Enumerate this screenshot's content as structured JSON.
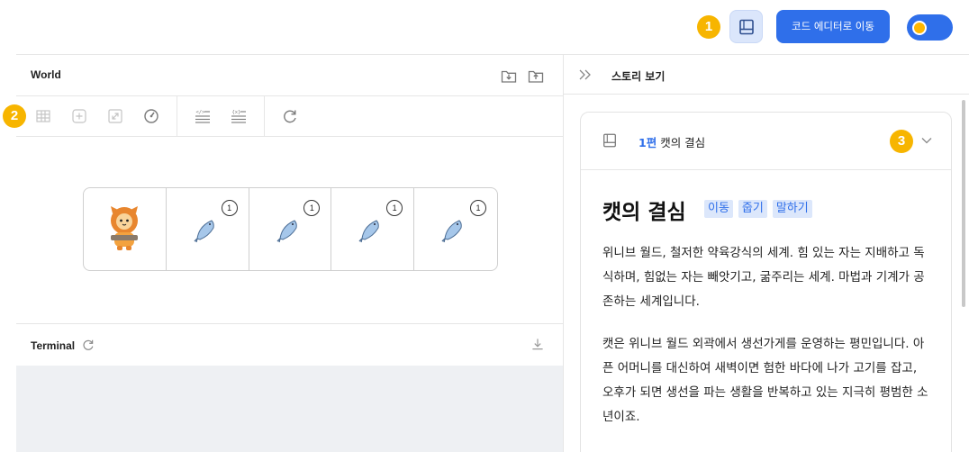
{
  "topbar": {
    "badge_1": "1",
    "code_editor_label": "코드 에디터로 이동",
    "story_icon": "book-icon",
    "theme_toggle": "theme-toggle",
    "colors": {
      "accent": "#2f6fea",
      "badge": "#f7b500"
    }
  },
  "world": {
    "title": "World",
    "badge_2": "2",
    "tools": [
      "grid-icon",
      "add-icon",
      "resize-icon",
      "speed-icon",
      "code-lines-icon",
      "list-lines-icon",
      "refresh-icon"
    ],
    "grid": [
      {
        "type": "cat",
        "icon": "cat-character-icon"
      },
      {
        "type": "fish",
        "icon": "fish-icon",
        "count": "1"
      },
      {
        "type": "fish",
        "icon": "fish-icon",
        "count": "1"
      },
      {
        "type": "fish",
        "icon": "fish-icon",
        "count": "1"
      },
      {
        "type": "fish",
        "icon": "fish-icon",
        "count": "1"
      }
    ]
  },
  "terminal": {
    "title": "Terminal"
  },
  "story": {
    "header_title": "스토리 보기",
    "badge_3": "3",
    "episode_number": "1편",
    "episode_name": "캣의 결심",
    "heading": "캣의 결심",
    "tags": [
      "이동",
      "줍기",
      "말하기"
    ],
    "paragraph_1": "위니브 월드, 철저한 약육강식의 세계. 힘 있는 자는 지배하고 독식하며, 힘없는 자는 빼앗기고, 굶주리는 세계. 마법과 기계가 공존하는 세계입니다.",
    "paragraph_2": "캣은 위니브 월드 외곽에서 생선가게를 운영하는 평민입니다. 아픈 어머니를 대신하여 새벽이면 험한 바다에 나가 고기를 잡고, 오후가 되면 생선을 파는 생활을 반복하고 있는 지극히 평범한 소년이죠."
  }
}
